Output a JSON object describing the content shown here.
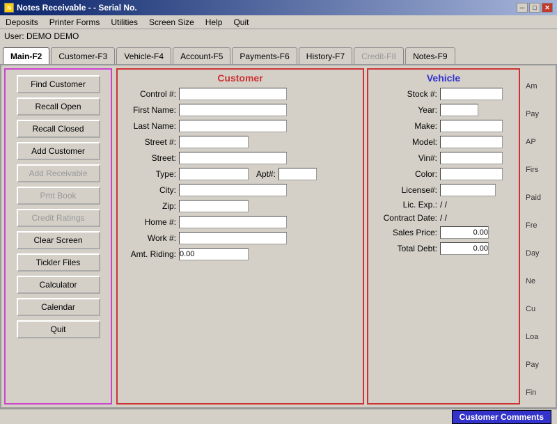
{
  "titlebar": {
    "icon": "N",
    "title": "Notes Receivable  -  - Serial No.",
    "minimize": "─",
    "maximize": "□",
    "close": "✕"
  },
  "menubar": {
    "items": [
      "Deposits",
      "Printer Forms",
      "Utilities",
      "Screen Size",
      "Help",
      "Quit"
    ]
  },
  "userbar": {
    "label": "User: DEMO DEMO"
  },
  "tabs": [
    {
      "label": "Main-F2",
      "active": true,
      "disabled": false
    },
    {
      "label": "Customer-F3",
      "active": false,
      "disabled": false
    },
    {
      "label": "Vehicle-F4",
      "active": false,
      "disabled": false
    },
    {
      "label": "Account-F5",
      "active": false,
      "disabled": false
    },
    {
      "label": "Payments-F6",
      "active": false,
      "disabled": false
    },
    {
      "label": "History-F7",
      "active": false,
      "disabled": false
    },
    {
      "label": "Credit-F8",
      "active": false,
      "disabled": true
    },
    {
      "label": "Notes-F9",
      "active": false,
      "disabled": false
    }
  ],
  "leftpanel": {
    "buttons": [
      {
        "label": "Find Customer",
        "disabled": false
      },
      {
        "label": "Recall Open",
        "disabled": false
      },
      {
        "label": "Recall Closed",
        "disabled": false
      },
      {
        "label": "Add Customer",
        "disabled": false
      },
      {
        "label": "Add Receivable",
        "disabled": true
      },
      {
        "label": "Pmt Book",
        "disabled": true
      },
      {
        "label": "Credit Ratings",
        "disabled": true
      },
      {
        "label": "Clear Screen",
        "disabled": false
      },
      {
        "label": "Tickler Files",
        "disabled": false
      },
      {
        "label": "Calculator",
        "disabled": false
      },
      {
        "label": "Calendar",
        "disabled": false
      },
      {
        "label": "Quit",
        "disabled": false
      }
    ]
  },
  "customer": {
    "title": "Customer",
    "fields": {
      "control_label": "Control #:",
      "firstname_label": "First Name:",
      "lastname_label": "Last Name:",
      "street_num_label": "Street #:",
      "street_label": "Street:",
      "type_label": "Type:",
      "apt_label": "Apt#:",
      "city_label": "City:",
      "zip_label": "Zip:",
      "home_label": "Home #:",
      "work_label": "Work #:",
      "amt_riding_label": "Amt. Riding:",
      "amt_riding_value": "0.00"
    }
  },
  "vehicle": {
    "title": "Vehicle",
    "fields": {
      "stock_label": "Stock #:",
      "year_label": "Year:",
      "make_label": "Make:",
      "model_label": "Model:",
      "vin_label": "Vin#:",
      "color_label": "Color:",
      "license_label": "License#:",
      "lic_exp_label": "Lic. Exp.:",
      "lic_exp_value": "/ /",
      "contract_label": "Contract Date:",
      "contract_value": "/ /",
      "sales_label": "Sales Price:",
      "sales_value": "0.00",
      "total_label": "Total Debt:",
      "total_value": "0.00"
    }
  },
  "rightpanel": {
    "labels": [
      "Am",
      "Pay",
      "AP",
      "Firs",
      "Paid",
      "Fre",
      "Day",
      "Ne",
      "Cu",
      "Loa",
      "Pay",
      "Fin"
    ]
  },
  "statusbar": {
    "customer_comments": "Customer Comments"
  }
}
